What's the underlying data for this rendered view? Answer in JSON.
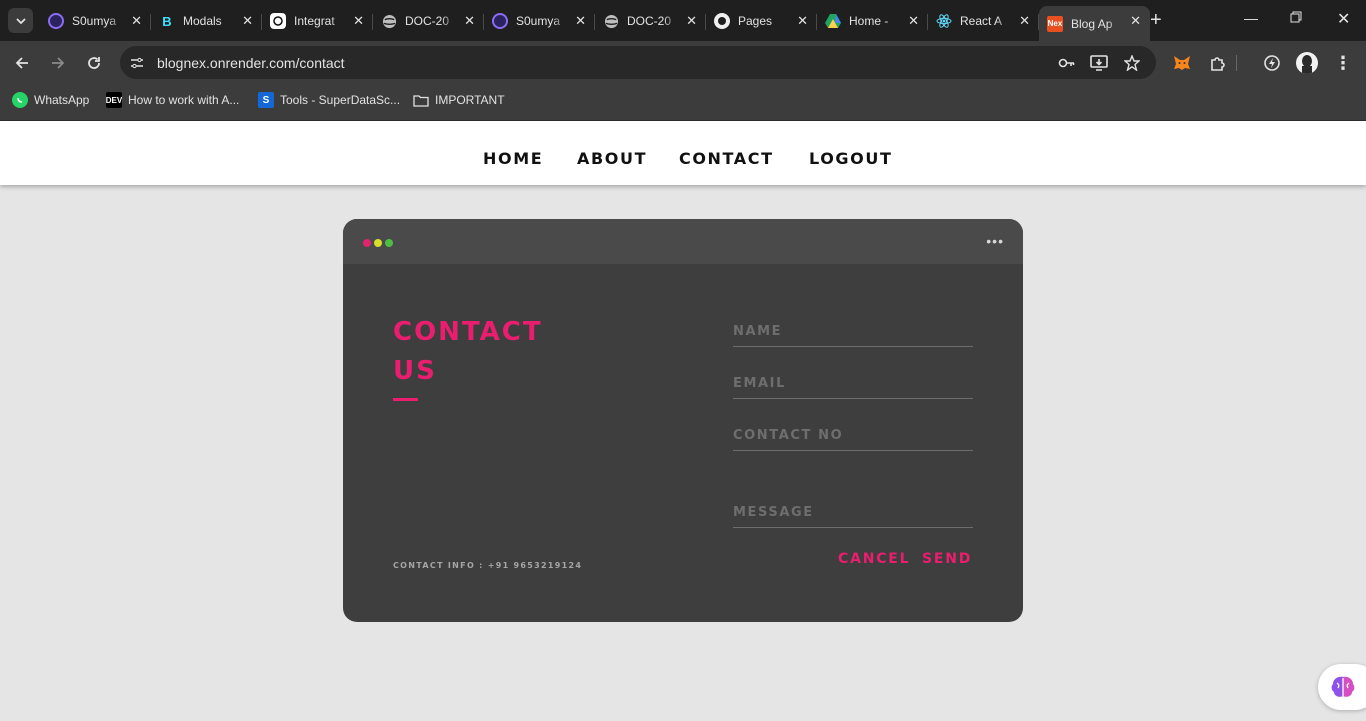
{
  "browser": {
    "tabs": [
      {
        "title": "S0umya",
        "icon": "purple-circle-icon"
      },
      {
        "title": "Modals",
        "icon": "react-bootstrap-icon"
      },
      {
        "title": "Integrat",
        "icon": "chatgpt-icon"
      },
      {
        "title": "DOC-20",
        "icon": "globe-icon"
      },
      {
        "title": "S0umya",
        "icon": "purple-circle-icon"
      },
      {
        "title": "DOC-20",
        "icon": "globe-icon"
      },
      {
        "title": "Pages",
        "icon": "github-icon"
      },
      {
        "title": "Home -",
        "icon": "google-drive-icon"
      },
      {
        "title": "React A",
        "icon": "react-icon"
      },
      {
        "title": "Blog Ap",
        "icon": "nex-icon",
        "fav_text": "Nex",
        "active": true
      }
    ],
    "url": "blognex.onrender.com/contact",
    "bookmarks": [
      {
        "label": "WhatsApp",
        "icon": "whatsapp-icon"
      },
      {
        "label": "How to work with A...",
        "icon": "dev-icon",
        "icon_text": "DEV"
      },
      {
        "label": "Tools - SuperDataSc...",
        "icon": "superdatascience-icon",
        "icon_text": "S"
      },
      {
        "label": "IMPORTANT",
        "icon": "folder-icon"
      }
    ]
  },
  "nav": {
    "home": "HOME",
    "about": "ABOUT",
    "contact": "CONTACT",
    "logout": "LOGOUT"
  },
  "contact_card": {
    "title_line1": "CONTACT",
    "title_line2": "US",
    "info": "CONTACT INFO : +91 9653219124",
    "fields": {
      "name_placeholder": "NAME",
      "email_placeholder": "EMAIL",
      "contact_placeholder": "CONTACT NO",
      "message_placeholder": "MESSAGE"
    },
    "cancel_label": "CANCEL",
    "send_label": "SEND"
  },
  "colors": {
    "accent": "#ea1d6f",
    "card": "#3e3e3e",
    "page_background": "#e5e5e5",
    "dot_red": "#e2246e",
    "dot_yellow": "#d7de2c",
    "dot_green": "#4ebf45"
  }
}
